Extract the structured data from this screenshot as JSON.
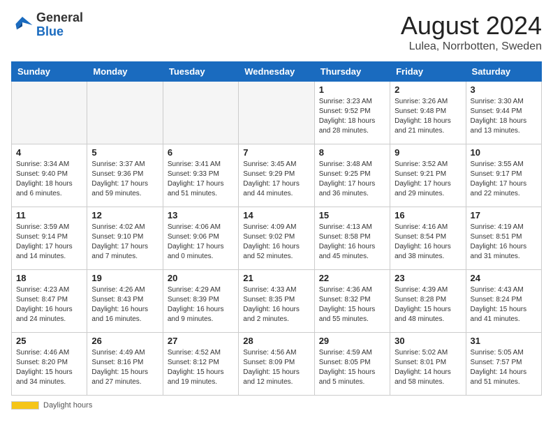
{
  "logo": {
    "general": "General",
    "blue": "Blue"
  },
  "title": "August 2024",
  "location": "Lulea, Norrbotten, Sweden",
  "days_of_week": [
    "Sunday",
    "Monday",
    "Tuesday",
    "Wednesday",
    "Thursday",
    "Friday",
    "Saturday"
  ],
  "footer": {
    "label": "Daylight hours"
  },
  "weeks": [
    [
      {
        "day": "",
        "info": ""
      },
      {
        "day": "",
        "info": ""
      },
      {
        "day": "",
        "info": ""
      },
      {
        "day": "",
        "info": ""
      },
      {
        "day": "1",
        "info": "Sunrise: 3:23 AM\nSunset: 9:52 PM\nDaylight: 18 hours\nand 28 minutes."
      },
      {
        "day": "2",
        "info": "Sunrise: 3:26 AM\nSunset: 9:48 PM\nDaylight: 18 hours\nand 21 minutes."
      },
      {
        "day": "3",
        "info": "Sunrise: 3:30 AM\nSunset: 9:44 PM\nDaylight: 18 hours\nand 13 minutes."
      }
    ],
    [
      {
        "day": "4",
        "info": "Sunrise: 3:34 AM\nSunset: 9:40 PM\nDaylight: 18 hours\nand 6 minutes."
      },
      {
        "day": "5",
        "info": "Sunrise: 3:37 AM\nSunset: 9:36 PM\nDaylight: 17 hours\nand 59 minutes."
      },
      {
        "day": "6",
        "info": "Sunrise: 3:41 AM\nSunset: 9:33 PM\nDaylight: 17 hours\nand 51 minutes."
      },
      {
        "day": "7",
        "info": "Sunrise: 3:45 AM\nSunset: 9:29 PM\nDaylight: 17 hours\nand 44 minutes."
      },
      {
        "day": "8",
        "info": "Sunrise: 3:48 AM\nSunset: 9:25 PM\nDaylight: 17 hours\nand 36 minutes."
      },
      {
        "day": "9",
        "info": "Sunrise: 3:52 AM\nSunset: 9:21 PM\nDaylight: 17 hours\nand 29 minutes."
      },
      {
        "day": "10",
        "info": "Sunrise: 3:55 AM\nSunset: 9:17 PM\nDaylight: 17 hours\nand 22 minutes."
      }
    ],
    [
      {
        "day": "11",
        "info": "Sunrise: 3:59 AM\nSunset: 9:14 PM\nDaylight: 17 hours\nand 14 minutes."
      },
      {
        "day": "12",
        "info": "Sunrise: 4:02 AM\nSunset: 9:10 PM\nDaylight: 17 hours\nand 7 minutes."
      },
      {
        "day": "13",
        "info": "Sunrise: 4:06 AM\nSunset: 9:06 PM\nDaylight: 17 hours\nand 0 minutes."
      },
      {
        "day": "14",
        "info": "Sunrise: 4:09 AM\nSunset: 9:02 PM\nDaylight: 16 hours\nand 52 minutes."
      },
      {
        "day": "15",
        "info": "Sunrise: 4:13 AM\nSunset: 8:58 PM\nDaylight: 16 hours\nand 45 minutes."
      },
      {
        "day": "16",
        "info": "Sunrise: 4:16 AM\nSunset: 8:54 PM\nDaylight: 16 hours\nand 38 minutes."
      },
      {
        "day": "17",
        "info": "Sunrise: 4:19 AM\nSunset: 8:51 PM\nDaylight: 16 hours\nand 31 minutes."
      }
    ],
    [
      {
        "day": "18",
        "info": "Sunrise: 4:23 AM\nSunset: 8:47 PM\nDaylight: 16 hours\nand 24 minutes."
      },
      {
        "day": "19",
        "info": "Sunrise: 4:26 AM\nSunset: 8:43 PM\nDaylight: 16 hours\nand 16 minutes."
      },
      {
        "day": "20",
        "info": "Sunrise: 4:29 AM\nSunset: 8:39 PM\nDaylight: 16 hours\nand 9 minutes."
      },
      {
        "day": "21",
        "info": "Sunrise: 4:33 AM\nSunset: 8:35 PM\nDaylight: 16 hours\nand 2 minutes."
      },
      {
        "day": "22",
        "info": "Sunrise: 4:36 AM\nSunset: 8:32 PM\nDaylight: 15 hours\nand 55 minutes."
      },
      {
        "day": "23",
        "info": "Sunrise: 4:39 AM\nSunset: 8:28 PM\nDaylight: 15 hours\nand 48 minutes."
      },
      {
        "day": "24",
        "info": "Sunrise: 4:43 AM\nSunset: 8:24 PM\nDaylight: 15 hours\nand 41 minutes."
      }
    ],
    [
      {
        "day": "25",
        "info": "Sunrise: 4:46 AM\nSunset: 8:20 PM\nDaylight: 15 hours\nand 34 minutes."
      },
      {
        "day": "26",
        "info": "Sunrise: 4:49 AM\nSunset: 8:16 PM\nDaylight: 15 hours\nand 27 minutes."
      },
      {
        "day": "27",
        "info": "Sunrise: 4:52 AM\nSunset: 8:12 PM\nDaylight: 15 hours\nand 19 minutes."
      },
      {
        "day": "28",
        "info": "Sunrise: 4:56 AM\nSunset: 8:09 PM\nDaylight: 15 hours\nand 12 minutes."
      },
      {
        "day": "29",
        "info": "Sunrise: 4:59 AM\nSunset: 8:05 PM\nDaylight: 15 hours\nand 5 minutes."
      },
      {
        "day": "30",
        "info": "Sunrise: 5:02 AM\nSunset: 8:01 PM\nDaylight: 14 hours\nand 58 minutes."
      },
      {
        "day": "31",
        "info": "Sunrise: 5:05 AM\nSunset: 7:57 PM\nDaylight: 14 hours\nand 51 minutes."
      }
    ]
  ]
}
